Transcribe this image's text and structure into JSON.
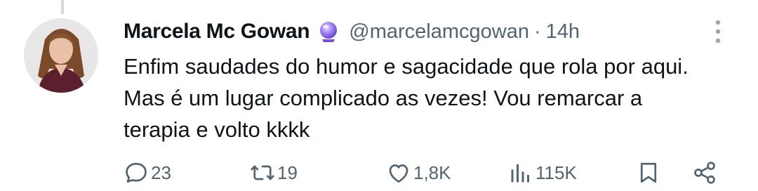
{
  "tweet": {
    "author_name": "Marcela Mc Gowan",
    "handle": "@marcelamcgowan",
    "separator": "·",
    "time": "14h",
    "badge_icon": "crystal-ball-icon",
    "text": "Enfim saudades do humor e sagacidade que rola por aqui.\nMas é um lugar complicado as vezes! Vou remarcar a\nterapia e volto kkkk"
  },
  "actions": {
    "reply_count": "23",
    "repost_count": "19",
    "like_count": "1,8K",
    "views_count": "115K"
  },
  "colors": {
    "text": "#0f1419",
    "muted": "#536471",
    "badge": "#8b5cf6"
  }
}
